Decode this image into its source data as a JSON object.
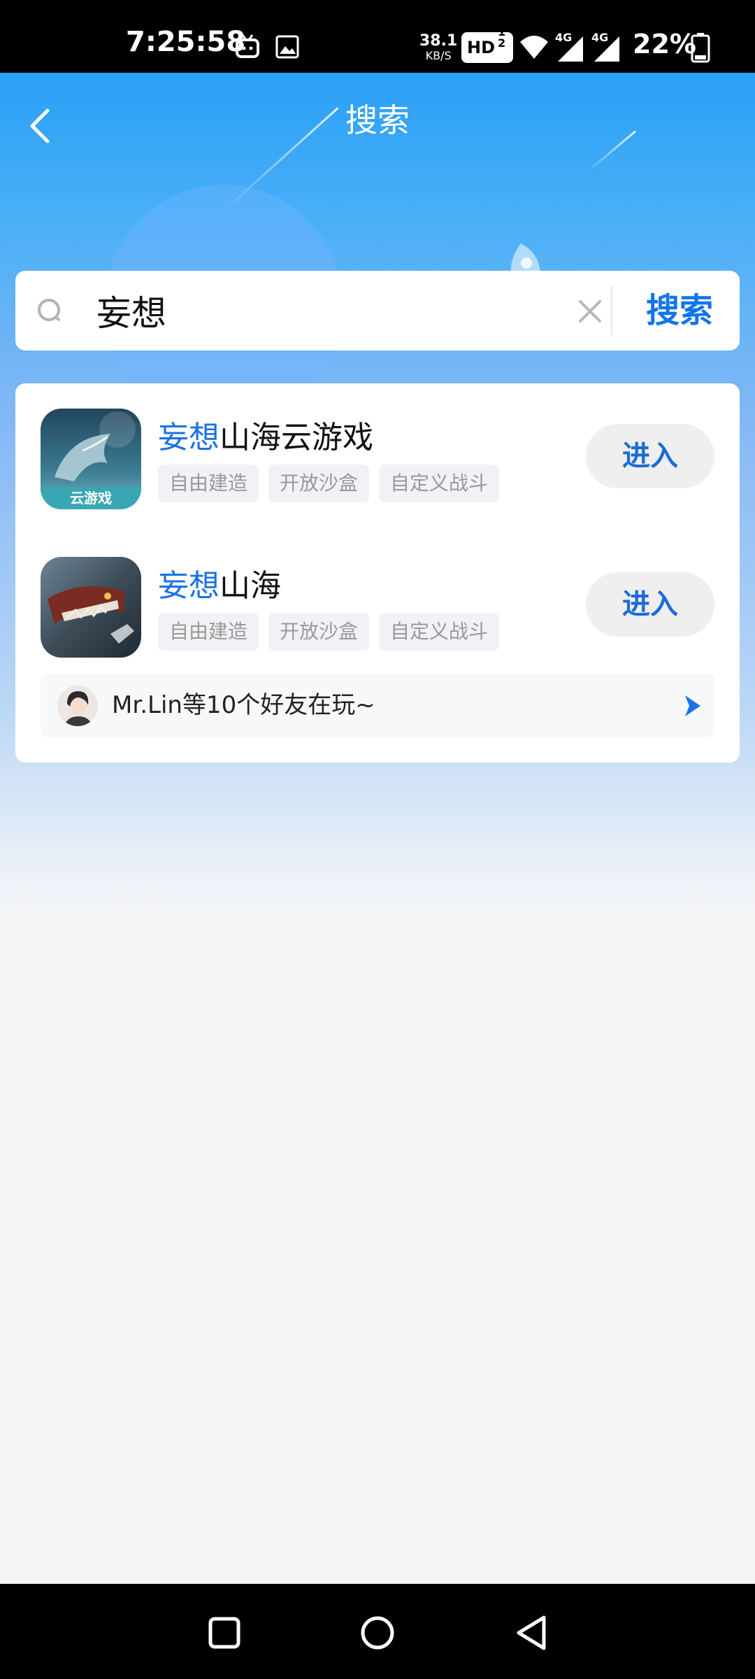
{
  "status_bar": {
    "time": "7:25:58",
    "net_speed_value": "38.1",
    "net_speed_unit": "KB/S",
    "hd_label": "HD",
    "hd_sims": "1 2",
    "signal_1_label": "4G",
    "signal_2_label": "4G",
    "battery": "22%",
    "icons": [
      "tv-icon",
      "image-icon",
      "wifi-icon",
      "signal-icon",
      "signal-icon",
      "battery-icon"
    ]
  },
  "header": {
    "title": "搜索",
    "back_icon": "chevron-left-icon"
  },
  "search": {
    "query": "妄想",
    "button_label": "搜索",
    "search_icon": "search-icon",
    "clear_icon": "close-icon"
  },
  "results": [
    {
      "title_highlight": "妄想",
      "title_rest": "山海云游戏",
      "icon_badge": "云游戏",
      "tags": [
        "自由建造",
        "开放沙盒",
        "自定义战斗"
      ],
      "button_label": "进入"
    },
    {
      "title_highlight": "妄想",
      "title_rest": "山海",
      "tags": [
        "自由建造",
        "开放沙盒",
        "自定义战斗"
      ],
      "button_label": "进入"
    }
  ],
  "friends": {
    "text": "Mr.Lin等10个好友在玩~",
    "arrow_icon": "chevron-right-icon"
  },
  "nav_bar": {
    "icons": [
      "recents-square-icon",
      "home-circle-icon",
      "back-triangle-icon"
    ]
  },
  "colors": {
    "accent": "#1a72e6",
    "header_blue": "#2aa0f6",
    "page_bg": "#f4f4f6"
  }
}
